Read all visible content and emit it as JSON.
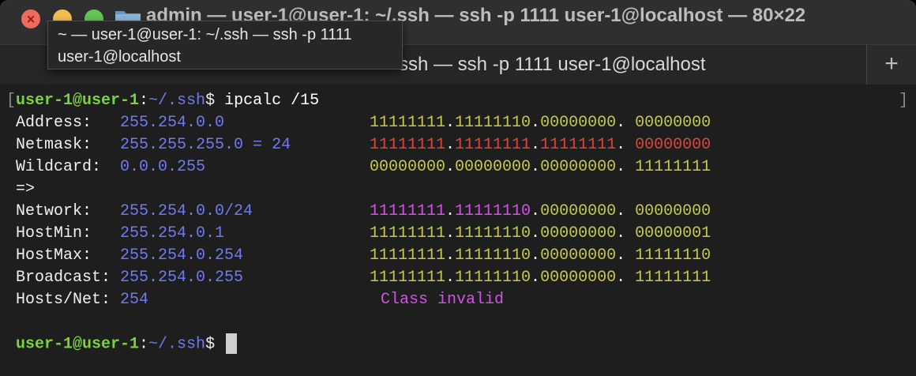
{
  "window": {
    "title": "admin — user-1@user-1: ~/.ssh — ssh -p 1111 user-1@localhost — 80×22"
  },
  "tab": {
    "label": "ssh — ssh -p 1111 user-1@localhost",
    "new_tab_label": "+"
  },
  "tooltip": {
    "line1": "~ — user-1@user-1: ~/.ssh — ssh -p 1111",
    "line2": "user-1@localhost"
  },
  "terminal": {
    "prompt_user": "user-1@user-1",
    "prompt_colon": ":",
    "prompt_path": "~/.ssh",
    "prompt_dollar": "$",
    "command": "ipcalc /15",
    "left_bracket": "[",
    "right_bracket": "]",
    "rows": {
      "address": {
        "label": "Address:   ",
        "value": "255.254.0.0",
        "b1": "11111111",
        "b2": "11111110",
        "b3": "00000000",
        "b4": "00000000"
      },
      "netmask": {
        "label": "Netmask:   ",
        "value": "255.255.255.0 = 24",
        "b1": "11111111",
        "b2": "11111111",
        "b3": "11111111",
        "b4": "00000000"
      },
      "wildcard": {
        "label": "Wildcard:  ",
        "value": "0.0.0.255",
        "b1": "00000000",
        "b2": "00000000",
        "b3": "00000000",
        "b4": "11111111"
      },
      "arrow": "=>",
      "network": {
        "label": "Network:   ",
        "value": "255.254.0.0/24",
        "b1": "11111111",
        "b2": "11111110",
        "b3": "00000000",
        "b4": "00000000"
      },
      "hostmin": {
        "label": "HostMin:   ",
        "value": "255.254.0.1",
        "b1": "11111111",
        "b2": "11111110",
        "b3": "00000000",
        "b4": "00000001"
      },
      "hostmax": {
        "label": "HostMax:   ",
        "value": "255.254.0.254",
        "b1": "11111111",
        "b2": "11111110",
        "b3": "00000000",
        "b4": "11111110"
      },
      "broadcast": {
        "label": "Broadcast: ",
        "value": "255.254.0.255",
        "b1": "11111111",
        "b2": "11111110",
        "b3": "00000000",
        "b4": "11111111"
      },
      "hosts": {
        "label": "Hosts/Net: ",
        "value": "254",
        "note": "Class invalid"
      }
    }
  },
  "colors": {
    "prompt_user": "#7bd23f",
    "prompt_path": "#6f79f2",
    "binary": "#c8c84c",
    "netmask_bits": "#d8473b",
    "network_bits": "#d550e4",
    "close_button": "#ed6a5e",
    "minimize_button": "#f5bf4f",
    "maximize_button": "#62c554"
  },
  "icons": [
    "close-icon",
    "folder-icon",
    "plus-icon"
  ]
}
